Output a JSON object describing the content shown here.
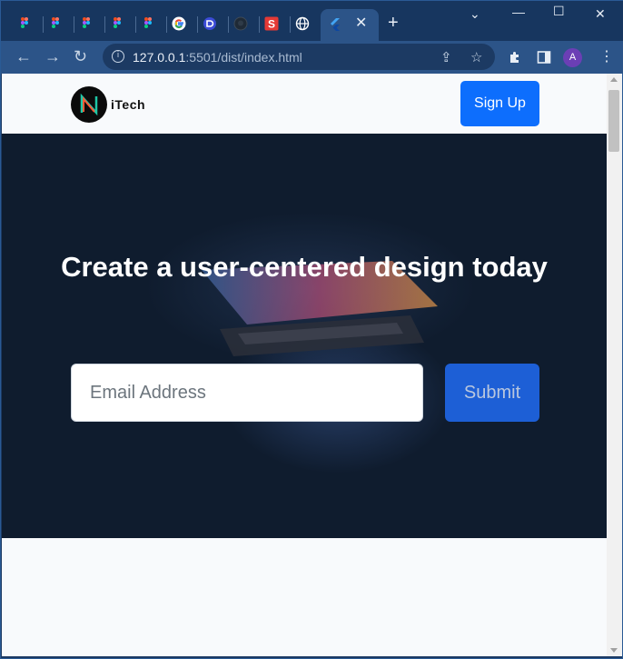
{
  "browser": {
    "address": "127.0.0.1",
    "address_rest": ":5501/dist/index.html",
    "avatar_letter": "A",
    "active_tab_close": "✕",
    "new_tab": "+",
    "tabs": [
      {
        "icon": "figma-icon"
      },
      {
        "icon": "figma-icon"
      },
      {
        "icon": "figma-icon"
      },
      {
        "icon": "figma-icon"
      },
      {
        "icon": "figma-icon"
      },
      {
        "icon": "google-icon"
      },
      {
        "icon": "app-icon"
      },
      {
        "icon": "github-icon"
      },
      {
        "icon": "s-app-icon"
      },
      {
        "icon": "globe-icon"
      },
      {
        "icon": "flutter-icon"
      }
    ],
    "s_letter": "S",
    "accent": "#2c5488"
  },
  "page": {
    "brand": "iTech",
    "signup_label": "Sign Up",
    "hero_title": "Create a user-centered design today",
    "email_placeholder": "Email Address",
    "submit_label": "Submit",
    "primary_color": "#0d6efd"
  }
}
